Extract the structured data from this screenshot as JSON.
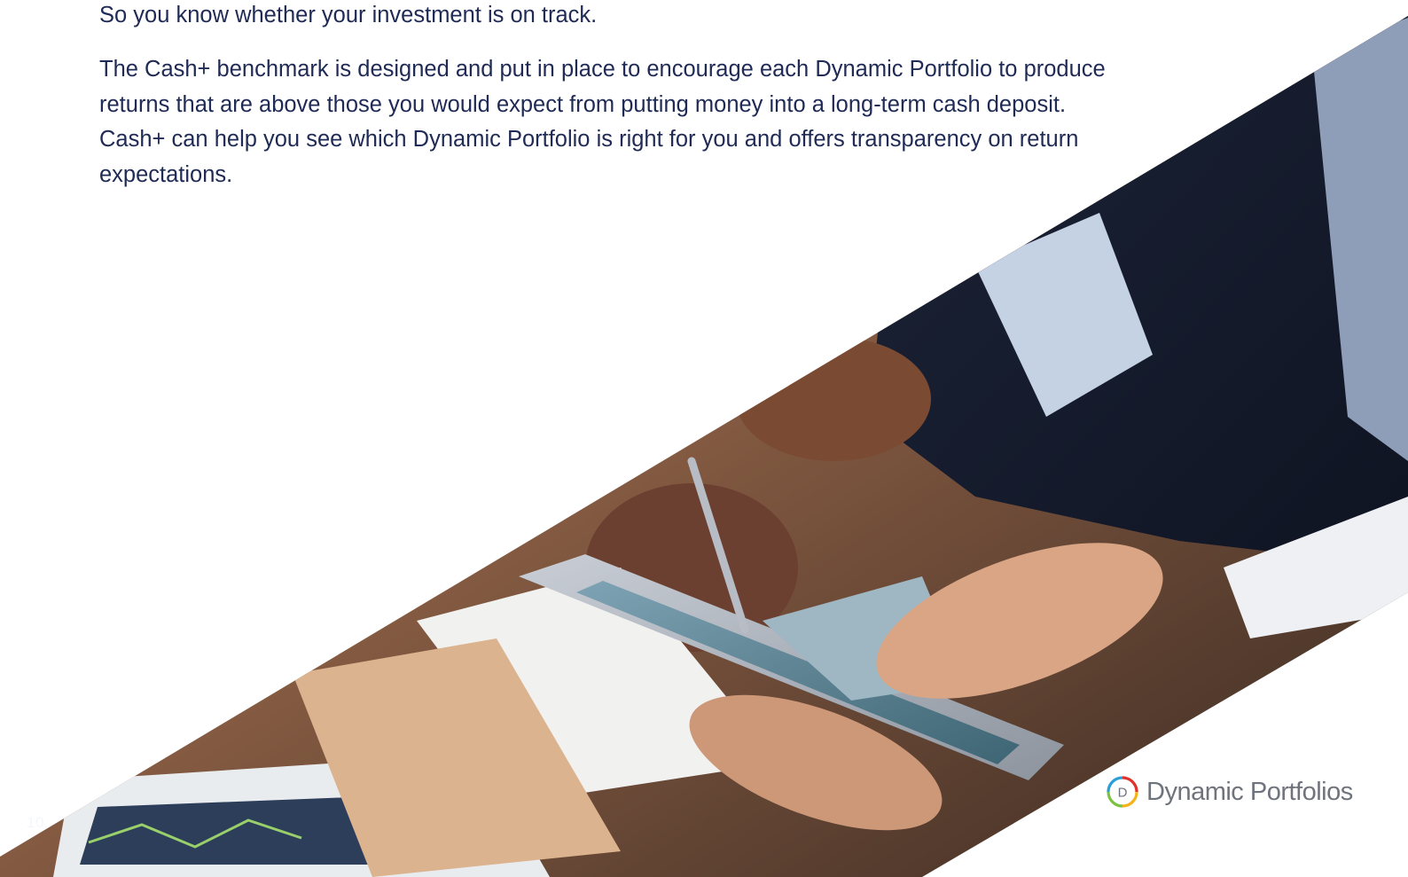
{
  "text": {
    "intro": "So you know whether your investment is on track.",
    "body": "The Cash+ benchmark is designed and put in place to encourage each Dynamic Portfolio to produce returns that are above those you would expect from putting money into a long-term cash deposit. Cash+ can help you see which Dynamic Portfolio is right for you and offers transparency on return expectations."
  },
  "footer": {
    "page_number": "10.",
    "brand_name": "Dynamic Portfolios",
    "logo_letter": "D"
  },
  "image": {
    "subject": "business people reviewing financial charts on a tablet"
  },
  "colors": {
    "text": "#1f2a55",
    "brand_text": "#6f737c",
    "logo_ring": [
      "#e0312b",
      "#f5b31a",
      "#7cc242",
      "#2a9fd8"
    ]
  }
}
